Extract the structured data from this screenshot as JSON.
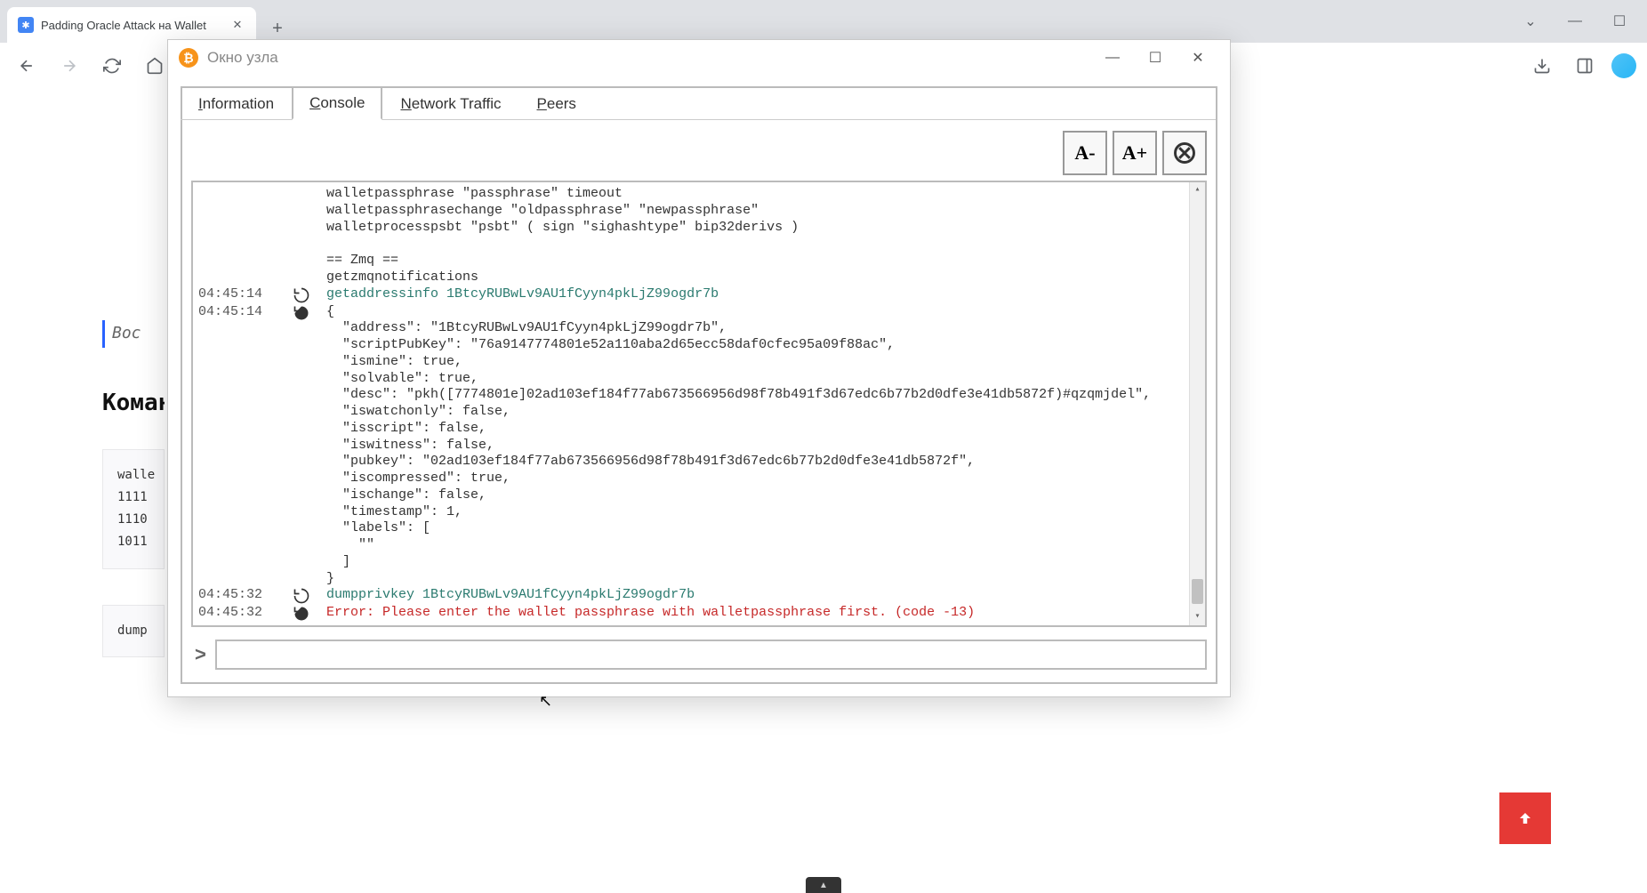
{
  "browser": {
    "tab_title": "Padding Oracle Attack на Wallet",
    "toolbar_right": {}
  },
  "page_hints": {
    "heading_partial": "Вос",
    "h2_partial": "Коман",
    "code1_lines": [
      "walle",
      "1111",
      "1110",
      "1011"
    ],
    "code2_line": "dump"
  },
  "node_window": {
    "title": "Окно узла",
    "tabs": {
      "information": "Information",
      "console": "Console",
      "network": "Network Traffic",
      "peers": "Peers"
    },
    "font_minus": "A-",
    "font_plus": "A+",
    "console": {
      "top_block": "walletpassphrase \"passphrase\" timeout\nwalletpassphrasechange \"oldpassphrase\" \"newpassphrase\"\nwalletprocesspsbt \"psbt\" ( sign \"sighashtype\" bip32derivs )\n\n== Zmq ==\ngetzmqnotifications",
      "entries": [
        {
          "ts": "04:45:14",
          "type": "cmd",
          "text": "getaddressinfo 1BtcyRUBwLv9AU1fCyyn4pkLjZ99ogdr7b"
        },
        {
          "ts": "04:45:14",
          "type": "out",
          "text": "{\n  \"address\": \"1BtcyRUBwLv9AU1fCyyn4pkLjZ99ogdr7b\",\n  \"scriptPubKey\": \"76a9147774801e52a110aba2d65ecc58daf0cfec95a09f88ac\",\n  \"ismine\": true,\n  \"solvable\": true,\n  \"desc\": \"pkh([7774801e]02ad103ef184f77ab673566956d98f78b491f3d67edc6b77b2d0dfe3e41db5872f)#qzqmjdel\",\n  \"iswatchonly\": false,\n  \"isscript\": false,\n  \"iswitness\": false,\n  \"pubkey\": \"02ad103ef184f77ab673566956d98f78b491f3d67edc6b77b2d0dfe3e41db5872f\",\n  \"iscompressed\": true,\n  \"ischange\": false,\n  \"timestamp\": 1,\n  \"labels\": [\n    \"\"\n  ]\n}"
        },
        {
          "ts": "04:45:32",
          "type": "cmd",
          "text": "dumpprivkey 1BtcyRUBwLv9AU1fCyyn4pkLjZ99ogdr7b"
        },
        {
          "ts": "04:45:32",
          "type": "err",
          "text": "Error: Please enter the wallet passphrase with walletpassphrase first. (code -13)"
        }
      ]
    },
    "prompt_value": ""
  }
}
